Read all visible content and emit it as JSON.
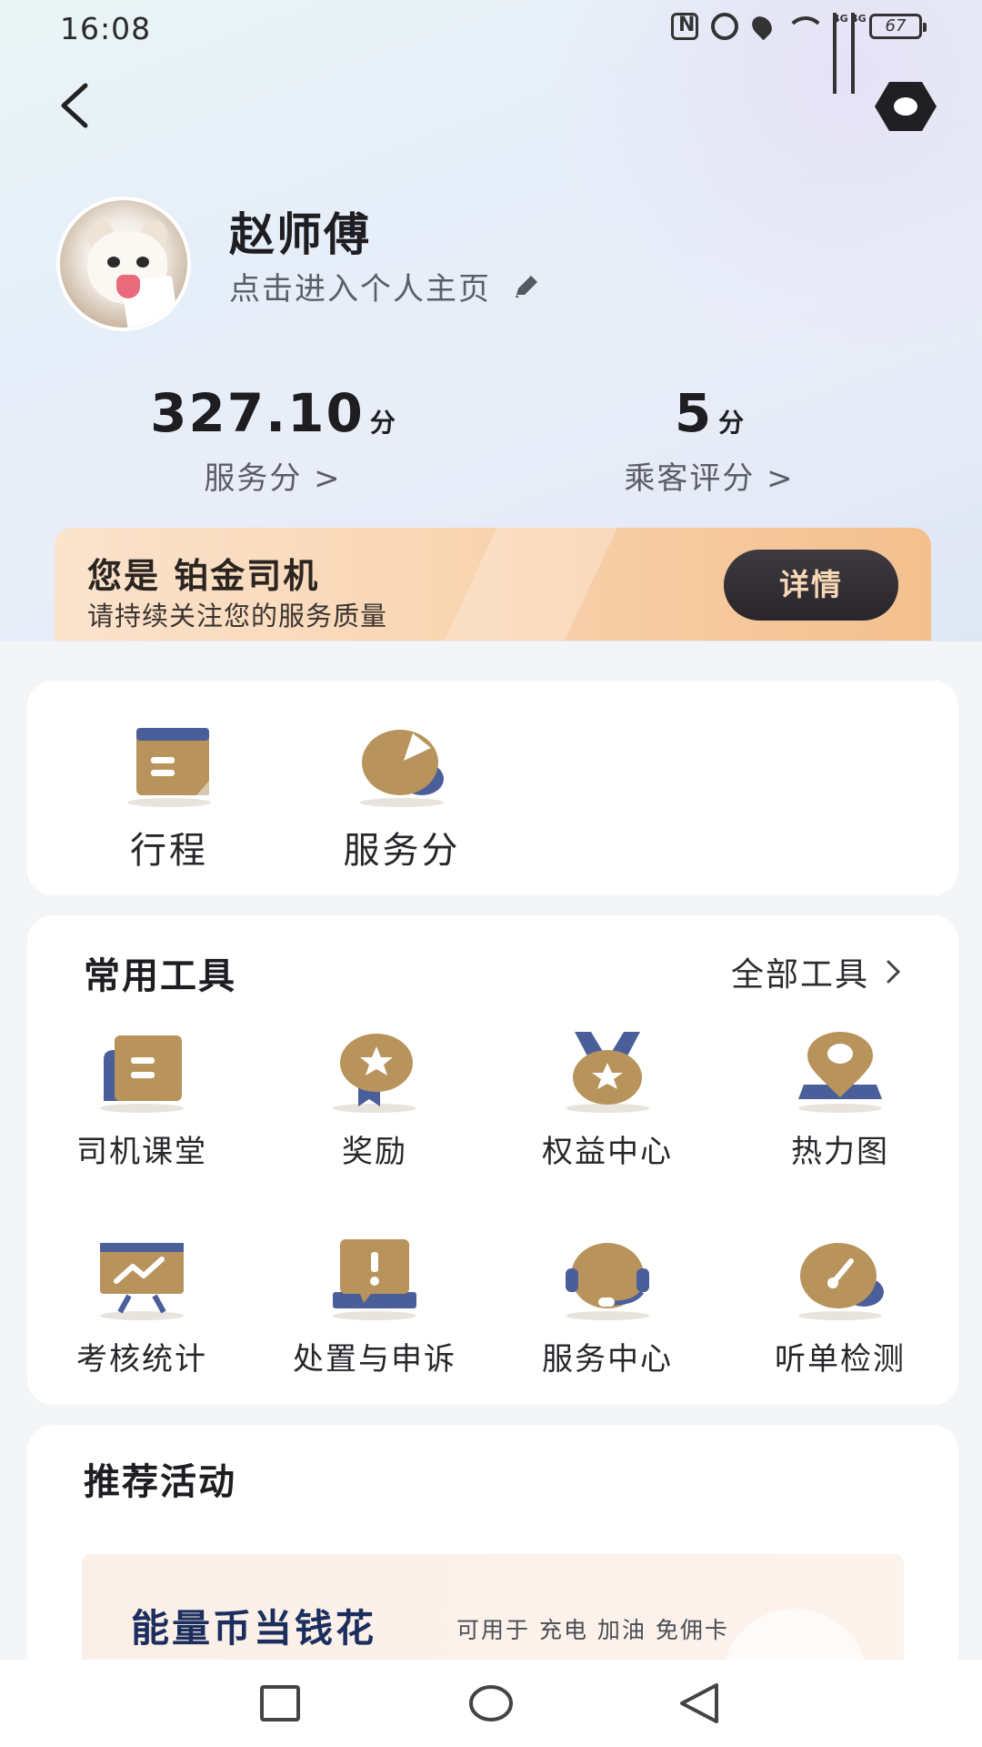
{
  "status_bar": {
    "time": "16:08",
    "network_tag_1": "4G",
    "network_tag_2": "4G",
    "battery": "67"
  },
  "header": {
    "back_icon": "chevron-left-icon",
    "settings_icon": "hexagon-settings-icon"
  },
  "profile": {
    "name": "赵师傅",
    "link_text": "点击进入个人主页",
    "edit_icon": "pencil-icon"
  },
  "scores": [
    {
      "value": "327.10",
      "unit": "分",
      "label": "服务分 >"
    },
    {
      "value": "5",
      "unit": "分",
      "label": "乘客评分 >"
    }
  ],
  "level_banner": {
    "title": "您是 铂金司机",
    "subtitle": "请持续关注您的服务质量",
    "button": "详情"
  },
  "quick_items": [
    {
      "label": "行程",
      "icon": "calendar-icon"
    },
    {
      "label": "服务分",
      "icon": "pie-chart-icon"
    }
  ],
  "tools": {
    "title": "常用工具",
    "more": "全部工具",
    "items": [
      {
        "label": "司机课堂",
        "icon": "book-icon"
      },
      {
        "label": "奖励",
        "icon": "star-badge-icon"
      },
      {
        "label": "权益中心",
        "icon": "medal-icon"
      },
      {
        "label": "热力图",
        "icon": "map-pin-icon"
      },
      {
        "label": "考核统计",
        "icon": "trend-chart-icon"
      },
      {
        "label": "处置与申诉",
        "icon": "alert-message-icon"
      },
      {
        "label": "服务中心",
        "icon": "headset-icon"
      },
      {
        "label": "听单检测",
        "icon": "gauge-icon"
      }
    ]
  },
  "promo": {
    "title": "推荐活动",
    "banner_head": "能量币当钱花",
    "banner_sub": "可用于 充电 加油 免佣卡"
  },
  "colors": {
    "gold": "#b8935c",
    "navy": "#4a5f9a",
    "banner_orange": "#f6caa0",
    "dark_button": "#2f2d32"
  }
}
